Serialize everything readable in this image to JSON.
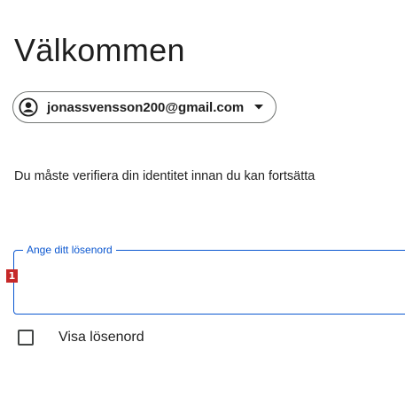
{
  "heading": {
    "title": "Välkommen"
  },
  "account": {
    "email": "jonassvensson200@gmail.com",
    "avatar_icon": "account-circle-icon",
    "caret_icon": "dropdown-caret-icon"
  },
  "info": {
    "text": "Du måste verifiera din identitet innan du kan fortsätta"
  },
  "password_field": {
    "label": "Ange ditt lösenord",
    "value": "",
    "marker": "1"
  },
  "show_password": {
    "label": "Visa lösenord",
    "checked": false
  },
  "colors": {
    "accent": "#0b57d0",
    "text": "#1f1f1f",
    "outline": "#747775",
    "marker": "#c62828"
  }
}
